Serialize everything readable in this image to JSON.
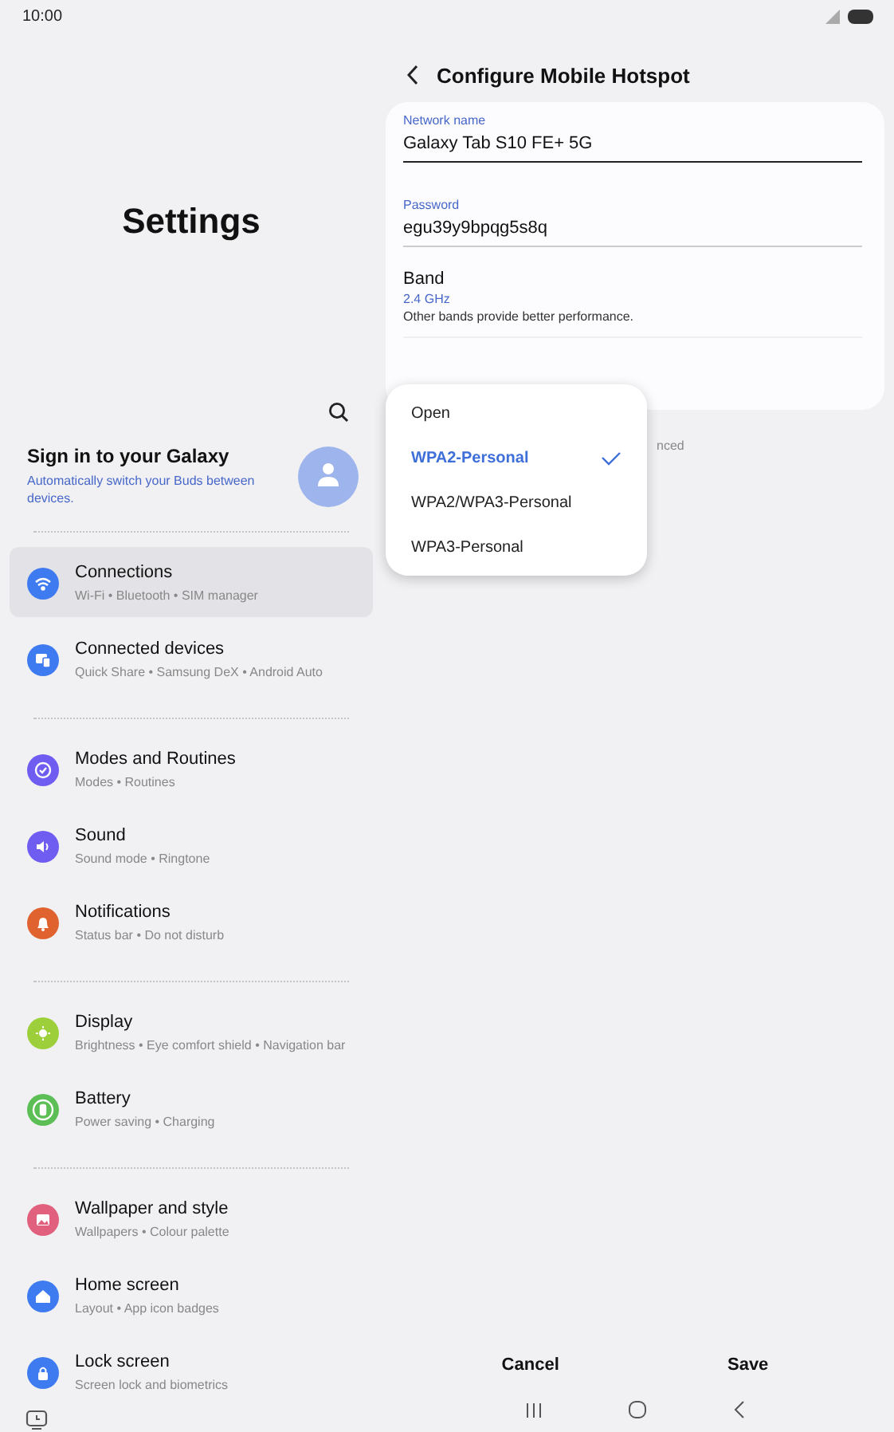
{
  "status_bar": {
    "time": "10:00"
  },
  "sidebar": {
    "title": "Settings",
    "account": {
      "title": "Sign in to your Galaxy",
      "subtitle": "Automatically switch your Buds between devices."
    },
    "groups": [
      [
        {
          "label": "Connections",
          "subtitle": "Wi-Fi  •  Bluetooth  •  SIM manager",
          "color": "#3f7bf0",
          "kind": "wifi",
          "selected": true
        },
        {
          "label": "Connected devices",
          "subtitle": "Quick Share  •  Samsung DeX  •  Android Auto",
          "color": "#3f7bf0",
          "kind": "devices",
          "selected": false
        }
      ],
      [
        {
          "label": "Modes and Routines",
          "subtitle": "Modes  •  Routines",
          "color": "#6f5cf0",
          "kind": "check",
          "selected": false
        },
        {
          "label": "Sound",
          "subtitle": "Sound mode  •  Ringtone",
          "color": "#6f5cf0",
          "kind": "sound",
          "selected": false
        },
        {
          "label": "Notifications",
          "subtitle": "Status bar  •  Do not disturb",
          "color": "#e0632f",
          "kind": "bell",
          "selected": false
        }
      ],
      [
        {
          "label": "Display",
          "subtitle": "Brightness  •  Eye comfort shield  •  Navigation bar",
          "color": "#9ccf3a",
          "kind": "sun",
          "selected": false
        },
        {
          "label": "Battery",
          "subtitle": "Power saving  •  Charging",
          "color": "#5cbf55",
          "kind": "battery",
          "selected": false
        }
      ],
      [
        {
          "label": "Wallpaper and style",
          "subtitle": "Wallpapers  •  Colour palette",
          "color": "#e0607e",
          "kind": "image",
          "selected": false
        },
        {
          "label": "Home screen",
          "subtitle": "Layout  •  App icon badges",
          "color": "#3f7bf0",
          "kind": "home",
          "selected": false
        },
        {
          "label": "Lock screen",
          "subtitle": "Screen lock and biometrics",
          "color": "#3f7bf0",
          "kind": "lock",
          "selected": false
        }
      ]
    ]
  },
  "detail": {
    "title": "Configure Mobile Hotspot",
    "network_name": {
      "label": "Network name",
      "value": "Galaxy Tab S10 FE+ 5G"
    },
    "password": {
      "label": "Password",
      "value": "egu39y9bpqg5s8q"
    },
    "band": {
      "label": "Band",
      "value": "2.4 GHz",
      "note": "Other bands provide better performance."
    },
    "partial_text": "nced",
    "security_menu": [
      {
        "label": "Open",
        "selected": false
      },
      {
        "label": "WPA2-Personal",
        "selected": true
      },
      {
        "label": "WPA2/WPA3-Personal",
        "selected": false
      },
      {
        "label": "WPA3-Personal",
        "selected": false
      }
    ],
    "buttons": [
      "Cancel",
      "Save"
    ]
  }
}
